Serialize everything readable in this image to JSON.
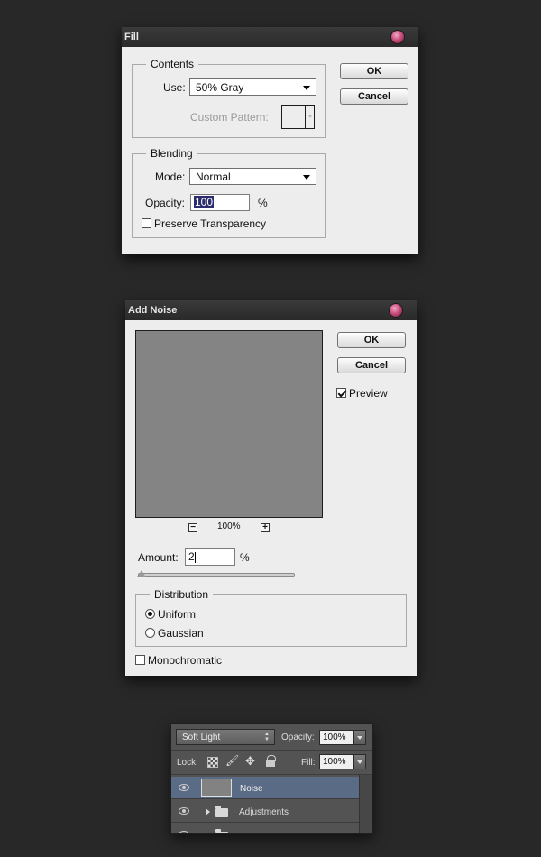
{
  "fill_dialog": {
    "title": "Fill",
    "contents": {
      "legend": "Contents",
      "use_label": "Use:",
      "use_value": "50% Gray",
      "custom_pattern_label": "Custom Pattern:"
    },
    "blending": {
      "legend": "Blending",
      "mode_label": "Mode:",
      "mode_value": "Normal",
      "opacity_label": "Opacity:",
      "opacity_value": "100",
      "opacity_unit": "%",
      "preserve_label": "Preserve Transparency",
      "preserve_checked": false
    },
    "ok_label": "OK",
    "cancel_label": "Cancel"
  },
  "noise_dialog": {
    "title": "Add Noise",
    "ok_label": "OK",
    "cancel_label": "Cancel",
    "preview_label": "Preview",
    "preview_checked": true,
    "zoom_level": "100%",
    "zoom_out_symbol": "−",
    "zoom_in_symbol": "+",
    "amount_label": "Amount:",
    "amount_value": "2",
    "amount_unit": "%",
    "distribution": {
      "legend": "Distribution",
      "options": [
        "Uniform",
        "Gaussian"
      ],
      "selected": "Uniform"
    },
    "monochromatic_label": "Monochromatic",
    "monochromatic_checked": false
  },
  "layers_panel": {
    "blend_mode": "Soft Light",
    "opacity_label": "Opacity:",
    "opacity_value": "100%",
    "lock_label": "Lock:",
    "fill_label": "Fill:",
    "fill_value": "100%",
    "layers": [
      {
        "name": "Noise",
        "selected": true
      },
      {
        "name": "Adjustments",
        "type": "group"
      }
    ]
  },
  "colors": {
    "background": "#282828",
    "dialog": "#ededed",
    "selected_layer": "#5a6b86",
    "panel": "#535353"
  }
}
